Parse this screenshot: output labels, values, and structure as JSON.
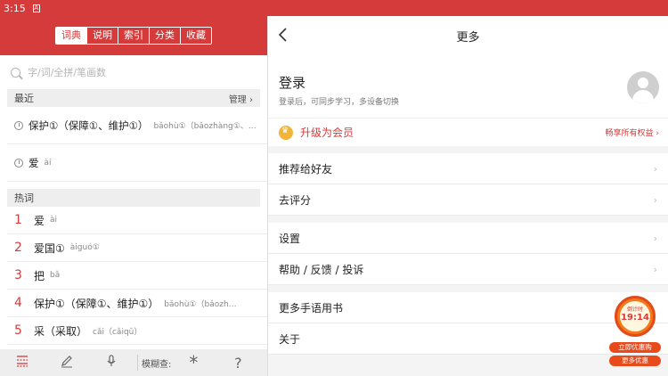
{
  "status": {
    "time": "3:15",
    "icon": "A"
  },
  "left": {
    "tabs": [
      "词典",
      "说明",
      "索引",
      "分类",
      "收藏"
    ],
    "active_tab": 0,
    "search_placeholder": "字/词/全拼/笔画数",
    "recent": {
      "title": "最近",
      "manage": "管理",
      "items": [
        {
          "word": "保护①（保障①、维护①）",
          "pinyin": "bǎohù①（bǎozhàng①、…"
        },
        {
          "word": "爱",
          "pinyin": "ài"
        }
      ]
    },
    "hot": {
      "title": "热词",
      "items": [
        {
          "num": "1",
          "word": "爱",
          "pinyin": "ài"
        },
        {
          "num": "2",
          "word": "爱国①",
          "pinyin": "àiguó①"
        },
        {
          "num": "3",
          "word": "把",
          "pinyin": "bǎ"
        },
        {
          "num": "4",
          "word": "保护①（保障①、维护①）",
          "pinyin": "bǎohù①（bǎozh…"
        },
        {
          "num": "5",
          "word": "采（采取）",
          "pinyin": "cǎi（cǎiqǔ）"
        }
      ]
    },
    "bottombar": {
      "fuzzy_label": "模糊查:",
      "star": "*",
      "help": "?"
    }
  },
  "right": {
    "title": "更多",
    "login": {
      "title": "登录",
      "subtitle": "登录后，可同步学习，多设备切换"
    },
    "vip": {
      "label": "升级为会员",
      "right": "畅享所有权益"
    },
    "rows": [
      {
        "label": "推荐给好友",
        "group": 1
      },
      {
        "label": "去评分",
        "group": 1
      },
      {
        "label": "设置",
        "group": 2
      },
      {
        "label": "帮助 / 反馈 / 投诉",
        "group": 2
      },
      {
        "label": "更多手语用书",
        "group": 3
      },
      {
        "label": "关于",
        "group": 3
      }
    ],
    "promo": {
      "countdown_label": "倒计时",
      "time": "19:14",
      "btn1": "立即优惠购",
      "btn2": "更多优惠"
    }
  },
  "colors": {
    "brand": "#d63b3b",
    "vip_gold": "#f1b53a",
    "promo_orange": "#f27a1a"
  }
}
